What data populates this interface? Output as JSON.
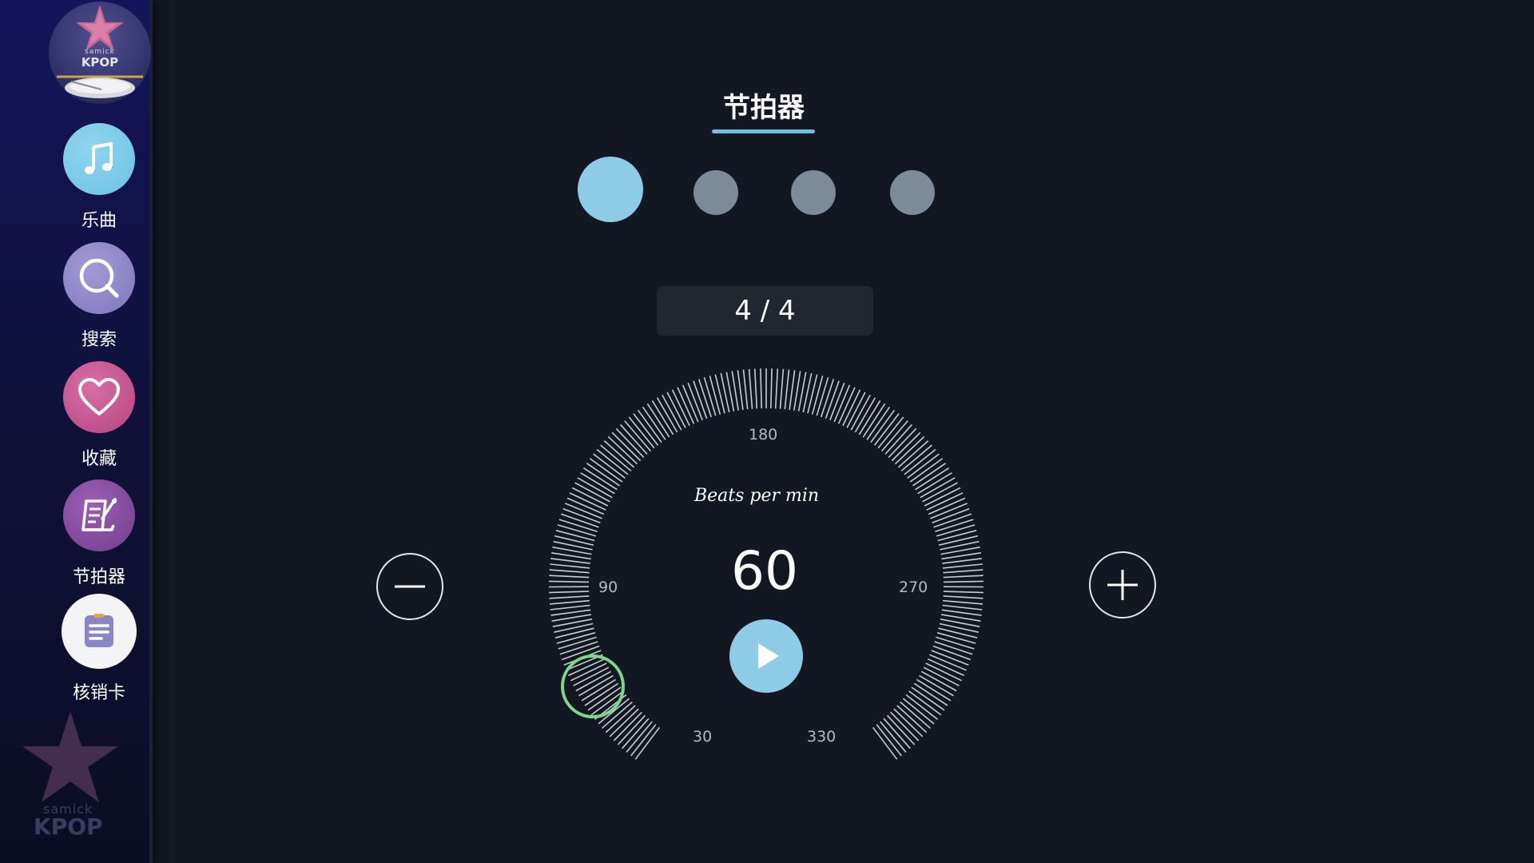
{
  "sidebar": {
    "logo": {
      "sub_text": "samick",
      "brand_text": "KPOP"
    },
    "items": [
      {
        "id": "songs",
        "label": "乐曲",
        "icon": "music-note-icon"
      },
      {
        "id": "search",
        "label": "搜索",
        "icon": "search-icon"
      },
      {
        "id": "favorites",
        "label": "收藏",
        "icon": "heart-icon"
      },
      {
        "id": "metronome",
        "label": "节拍器",
        "icon": "metronome-notepad-icon"
      },
      {
        "id": "card",
        "label": "核销卡",
        "icon": "document-icon"
      }
    ],
    "watermark": {
      "sub_text": "samick",
      "brand_text": "KPOP"
    }
  },
  "metronome": {
    "title": "节拍器",
    "beats_total": 4,
    "beats_active": 1,
    "time_signature": "4 / 4",
    "caption": "Beats per min",
    "bpm": 60,
    "scale_labels": {
      "top": "180",
      "left": "90",
      "right": "270",
      "bottom_left": "30",
      "bottom_right": "330"
    }
  },
  "colors": {
    "accent": "#8dcbe6",
    "inactive_dot": "#7d8a98",
    "background": "#131722",
    "knob": "#7ed68c"
  }
}
